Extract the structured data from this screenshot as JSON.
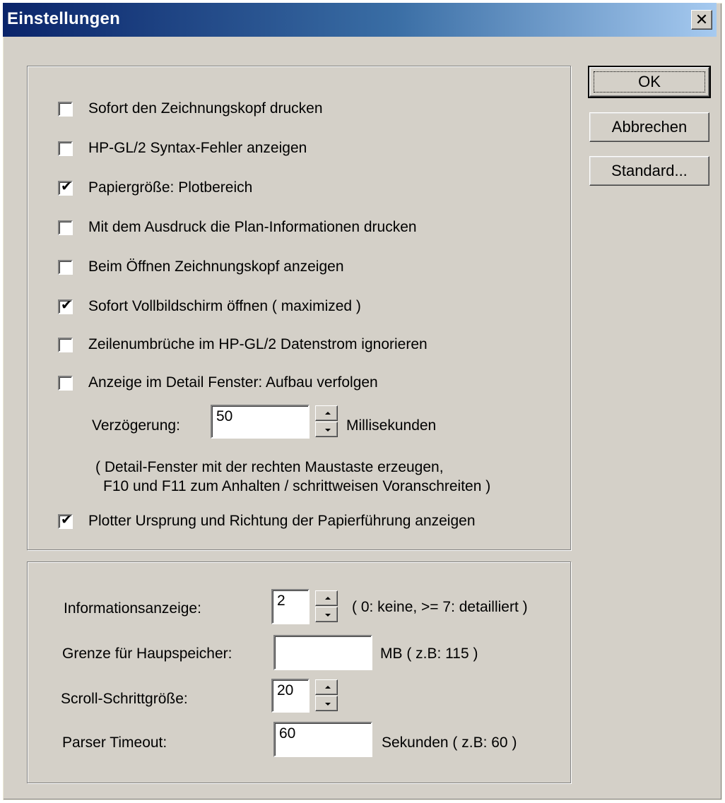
{
  "window": {
    "title": "Einstellungen",
    "close_glyph": "✕"
  },
  "buttons": {
    "ok": "OK",
    "cancel": "Abbrechen",
    "standard": "Standard..."
  },
  "options": [
    {
      "label": "Sofort den Zeichnungskopf drucken",
      "checked": false
    },
    {
      "label": "HP-GL/2 Syntax-Fehler anzeigen",
      "checked": false
    },
    {
      "label": "Papiergröße: Plotbereich",
      "checked": true
    },
    {
      "label": "Mit dem Ausdruck die Plan-Informationen drucken",
      "checked": false
    },
    {
      "label": "Beim Öffnen Zeichnungskopf anzeigen",
      "checked": false
    },
    {
      "label": "Sofort Vollbildschirm öffnen ( maximized )",
      "checked": true
    },
    {
      "label": "Zeilenumbrüche im HP-GL/2 Datenstrom ignorieren",
      "checked": false
    },
    {
      "label": "Anzeige im Detail Fenster: Aufbau verfolgen",
      "checked": false
    }
  ],
  "delay": {
    "label": "Verzögerung:",
    "value": "50",
    "unit": "Millisekunden"
  },
  "detail_hint": {
    "line1": "( Detail-Fenster mit der rechten Maustaste erzeugen,",
    "line2": "F10 und F11 zum Anhalten / schrittweisen Voranschreiten )"
  },
  "plotter_option": {
    "label": "Plotter Ursprung und Richtung der Papierführung anzeigen",
    "checked": true
  },
  "settings": {
    "info": {
      "label": "Informationsanzeige:",
      "value": "2",
      "hint": "( 0: keine, >= 7: detailliert )"
    },
    "memory": {
      "label": "Grenze für Haupspeicher:",
      "value": "",
      "hint": "MB  ( z.B: 115 )"
    },
    "scroll": {
      "label": "Scroll-Schrittgröße:",
      "value": "20"
    },
    "timeout": {
      "label": "Parser Timeout:",
      "value": "60",
      "hint": "Sekunden ( z.B: 60 )"
    }
  }
}
